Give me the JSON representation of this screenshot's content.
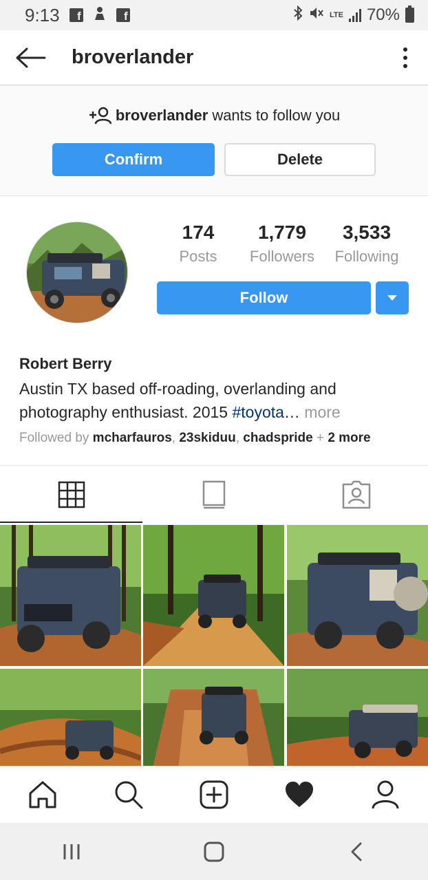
{
  "status_bar": {
    "time": "9:13",
    "network": "LTE",
    "battery": "70%"
  },
  "header": {
    "username": "broverlander"
  },
  "follow_request": {
    "username": "broverlander",
    "message": "wants to follow you",
    "confirm_label": "Confirm",
    "delete_label": "Delete"
  },
  "profile": {
    "stats": [
      {
        "value": "174",
        "label": "Posts"
      },
      {
        "value": "1,779",
        "label": "Followers"
      },
      {
        "value": "3,533",
        "label": "Following"
      }
    ],
    "follow_label": "Follow",
    "name": "Robert Berry",
    "bio_line1": "Austin TX based off-roading, overlanding and",
    "bio_line2": "photography enthusiast. 2015 ",
    "bio_hashtag": "#toyota",
    "bio_ellipsis": "…",
    "bio_more": " more",
    "followed_by_prefix": "Followed by ",
    "followed_by_users": [
      "mcharfauros",
      "23skiduu",
      "chadspride"
    ],
    "followed_by_extra": "2 more"
  },
  "tabs": [
    {
      "name": "grid-icon",
      "active": true
    },
    {
      "name": "feed-icon",
      "active": false
    },
    {
      "name": "tagged-icon",
      "active": false
    }
  ],
  "bottom_nav": [
    "home-icon",
    "search-icon",
    "add-post-icon",
    "activity-heart-icon",
    "profile-icon"
  ],
  "colors": {
    "accent": "#3897f0",
    "hashtag": "#003569",
    "muted": "#999999"
  }
}
